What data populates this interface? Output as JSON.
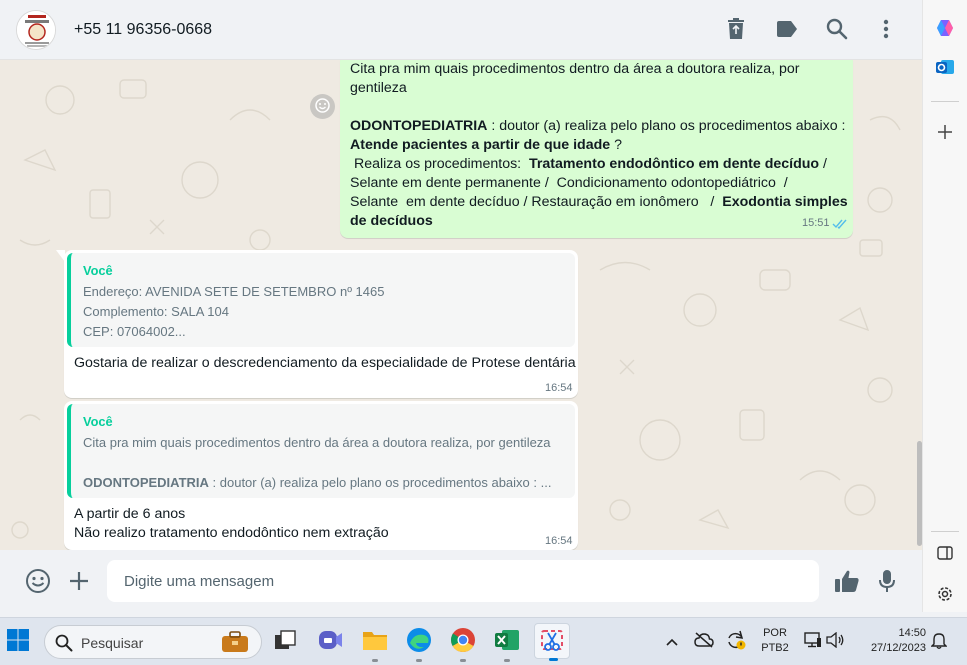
{
  "header": {
    "contact_name": "+55 11 96356-0668"
  },
  "messages": {
    "outgoing": {
      "line1": "Cita pra mim quais procedimentos dentro da área a doutora realiza, por",
      "line2": "gentileza",
      "specialty": "ODONTOPEDIATRIA",
      "intro": " :  doutor (a) realiza pelo plano os procedimentos abaixo :",
      "age_question": "Atende pacientes a partir de que idade",
      "age_q_mark": " ?",
      "proc_prefix": " Realiza os procedimentos:  ",
      "proc_bold1": "Tratamento endodôntico em dente decíduo",
      "proc_sep1": " /",
      "proc_line3": "Selante em dente permanente /  Condicionamento odontopediátrico  /",
      "proc_line4": "Selante  em dente decíduo / Restauração em ionômero   /  ",
      "proc_bold2a": "Exodontia simples",
      "proc_bold2b": "de decíduos",
      "time": "15:51"
    },
    "reply1": {
      "quote_author": "Você",
      "quote_line1": "Endereço: AVENIDA SETE DE SETEMBRO nº 1465",
      "quote_line2": "Complemento: SALA 104",
      "quote_line3": "CEP: 07064002...",
      "text": "Gostaria de realizar o descredenciamento da especialidade de Protese dentária",
      "time": "16:54"
    },
    "reply2": {
      "quote_author": "Você",
      "quote_line1": "Cita pra mim quais procedimentos dentro da área a doutora realiza, por gentileza",
      "quote_bold": "ODONTOPEDIATRIA",
      "quote_line2_rest": " :  doutor (a) realiza pelo plano os procedimentos abaixo :  ...",
      "text_line1": "A partir de 6 anos",
      "text_line2": "Não realizo tratamento endodôntico nem extração",
      "time": "16:54"
    }
  },
  "composer": {
    "placeholder": "Digite uma mensagem"
  },
  "taskbar": {
    "search_label": "Pesquisar",
    "lang_line1": "POR",
    "lang_line2": "PTB2",
    "clock_time": "14:50",
    "clock_date": "27/12/2023"
  },
  "colors": {
    "outgoing_bubble": "#d9fdd3",
    "incoming_bubble": "#ffffff",
    "accent": "#06cf9c",
    "read_ticks": "#53bdeb"
  }
}
